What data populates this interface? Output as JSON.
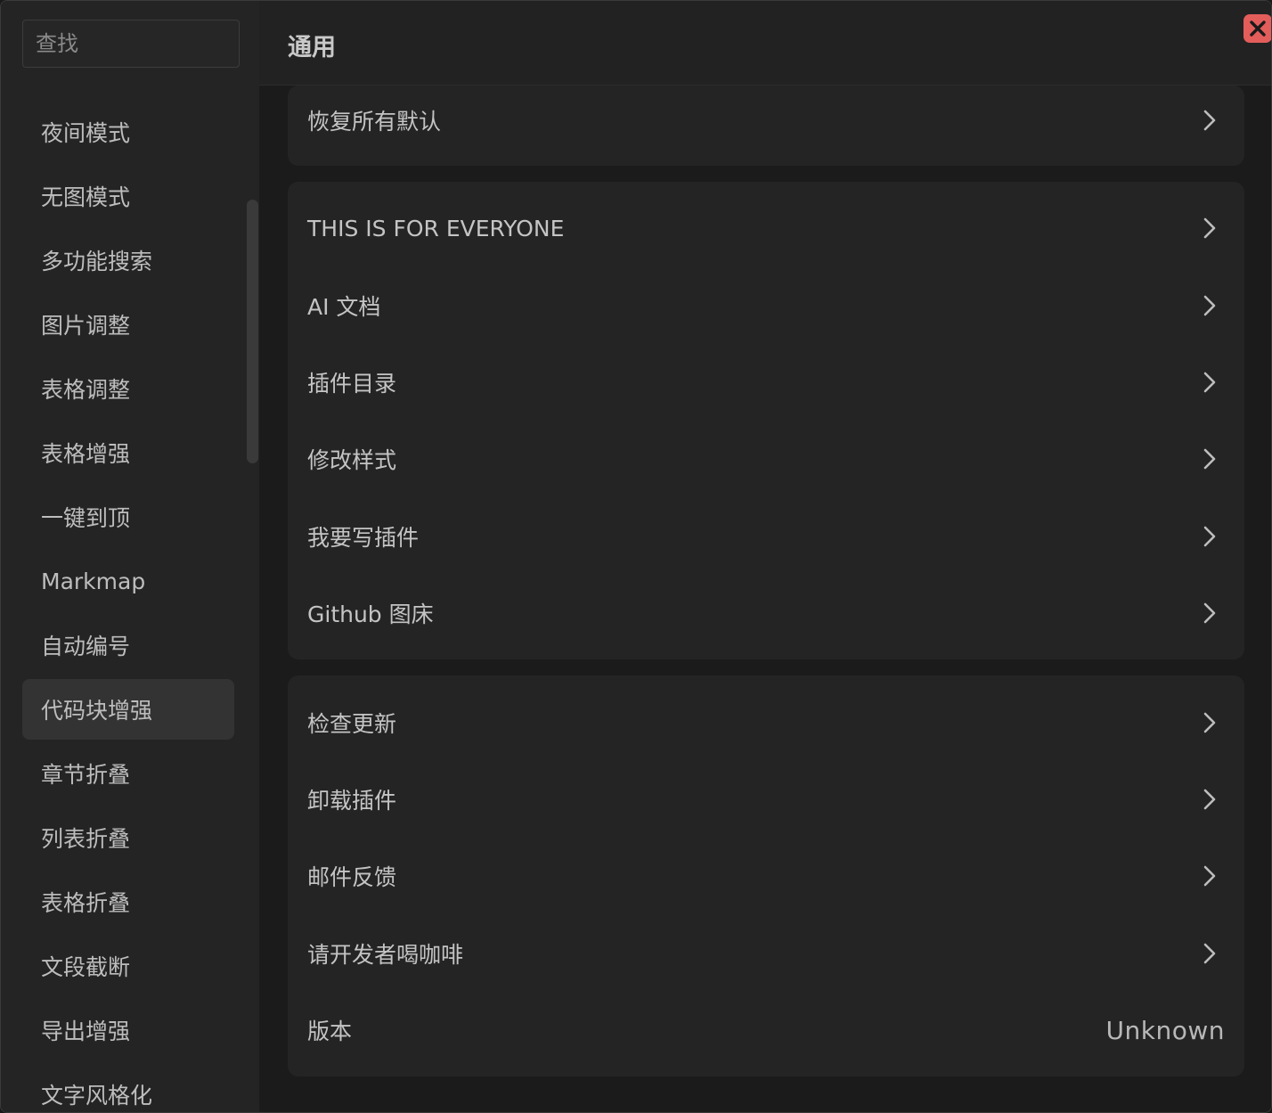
{
  "sidebar": {
    "search_placeholder": "查找",
    "items": [
      {
        "label": "夜间模式"
      },
      {
        "label": "无图模式"
      },
      {
        "label": "多功能搜索"
      },
      {
        "label": "图片调整"
      },
      {
        "label": "表格调整"
      },
      {
        "label": "表格增强"
      },
      {
        "label": "一键到顶"
      },
      {
        "label": "Markmap"
      },
      {
        "label": "自动编号"
      },
      {
        "label": "代码块增强",
        "active": true
      },
      {
        "label": "章节折叠"
      },
      {
        "label": "列表折叠"
      },
      {
        "label": "表格折叠"
      },
      {
        "label": "文段截断"
      },
      {
        "label": "导出增强"
      },
      {
        "label": "文字风格化"
      }
    ]
  },
  "header": {
    "title": "通用"
  },
  "groups": [
    {
      "rows": [
        {
          "label": "恢复所有默认"
        }
      ]
    },
    {
      "rows": [
        {
          "label": "THIS IS FOR EVERYONE"
        },
        {
          "label": "AI 文档"
        },
        {
          "label": "插件目录"
        },
        {
          "label": "修改样式"
        },
        {
          "label": "我要写插件"
        },
        {
          "label": "Github 图床"
        }
      ]
    },
    {
      "rows": [
        {
          "label": "检查更新"
        },
        {
          "label": "卸载插件"
        },
        {
          "label": "邮件反馈"
        },
        {
          "label": "请开发者喝咖啡"
        },
        {
          "label": "版本",
          "value": "Unknown"
        }
      ]
    }
  ],
  "colors": {
    "close_button": "#e35d5b",
    "sidebar_bg": "#242424",
    "active_item_bg": "#333333"
  }
}
